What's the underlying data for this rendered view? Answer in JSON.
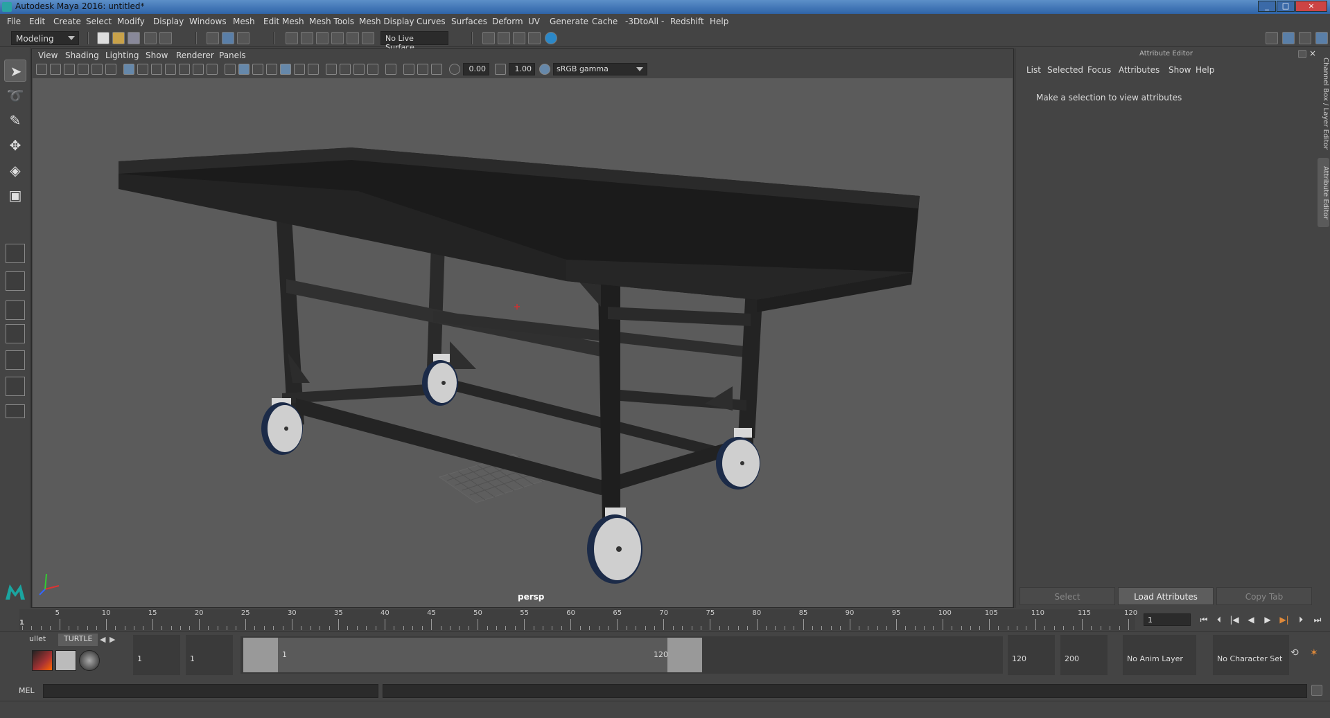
{
  "window": {
    "title": "Autodesk Maya 2016: untitled*",
    "controls": [
      "_",
      "□",
      "×"
    ]
  },
  "menubar": {
    "items": [
      "File",
      "Edit",
      "Create",
      "Select",
      "Modify",
      "Display",
      "Windows",
      "Mesh",
      "Edit Mesh",
      "Mesh Tools",
      "Mesh Display",
      "Curves",
      "Surfaces",
      "Deform",
      "UV",
      "Generate",
      "Cache",
      "-3DtoAll -",
      "Redshift",
      "Help"
    ]
  },
  "statusline": {
    "mode": "Modeling",
    "live_surface": "No Live Surface"
  },
  "viewport": {
    "menus": [
      "View",
      "Shading",
      "Lighting",
      "Show",
      "Renderer",
      "Panels"
    ],
    "exposure": "0.00",
    "gamma": "1.00",
    "color_space": "sRGB gamma",
    "camera_label": "persp"
  },
  "attribute_editor": {
    "title": "Attribute Editor",
    "menus": [
      "List",
      "Selected",
      "Focus",
      "Attributes",
      "Show",
      "Help"
    ],
    "message": "Make a selection to view attributes",
    "buttons": {
      "select": "Select",
      "load": "Load Attributes",
      "copy": "Copy Tab"
    }
  },
  "side_tabs": {
    "channel_box": "Channel Box / Layer Editor",
    "attribute_editor": "Attribute Editor"
  },
  "timeslider": {
    "ticks": [
      "5",
      "10",
      "15",
      "20",
      "25",
      "30",
      "35",
      "40",
      "45",
      "50",
      "55",
      "60",
      "65",
      "70",
      "75",
      "80",
      "85",
      "90",
      "95",
      "100",
      "105",
      "110",
      "115",
      "120"
    ],
    "current_frame_marker": "1",
    "current_frame": "1"
  },
  "rangeslider": {
    "shelf_tabs": [
      "ullet",
      "TURTLE"
    ],
    "start_time": "1",
    "playback_start": "1",
    "range_start_label": "1",
    "range_end_label": "120",
    "playback_end": "120",
    "end_time": "200",
    "anim_layer": "No Anim Layer",
    "character_set": "No Character Set"
  },
  "cmdline": {
    "label": "MEL"
  },
  "colors": {
    "viewport_bg": "#5b5b5b",
    "ui_bg": "#444444",
    "accent": "#5a7fa8"
  }
}
